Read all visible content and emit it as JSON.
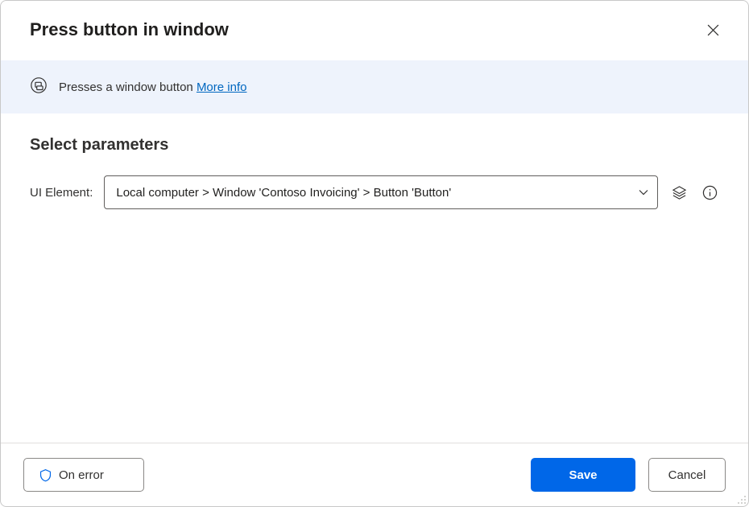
{
  "header": {
    "title": "Press button in window"
  },
  "banner": {
    "icon": "action-icon",
    "text": "Presses a window button",
    "link_label": "More info"
  },
  "section": {
    "title": "Select parameters"
  },
  "params": {
    "ui_element": {
      "label": "UI Element:",
      "value": "Local computer > Window 'Contoso Invoicing' > Button 'Button'"
    }
  },
  "footer": {
    "on_error": "On error",
    "save": "Save",
    "cancel": "Cancel"
  }
}
